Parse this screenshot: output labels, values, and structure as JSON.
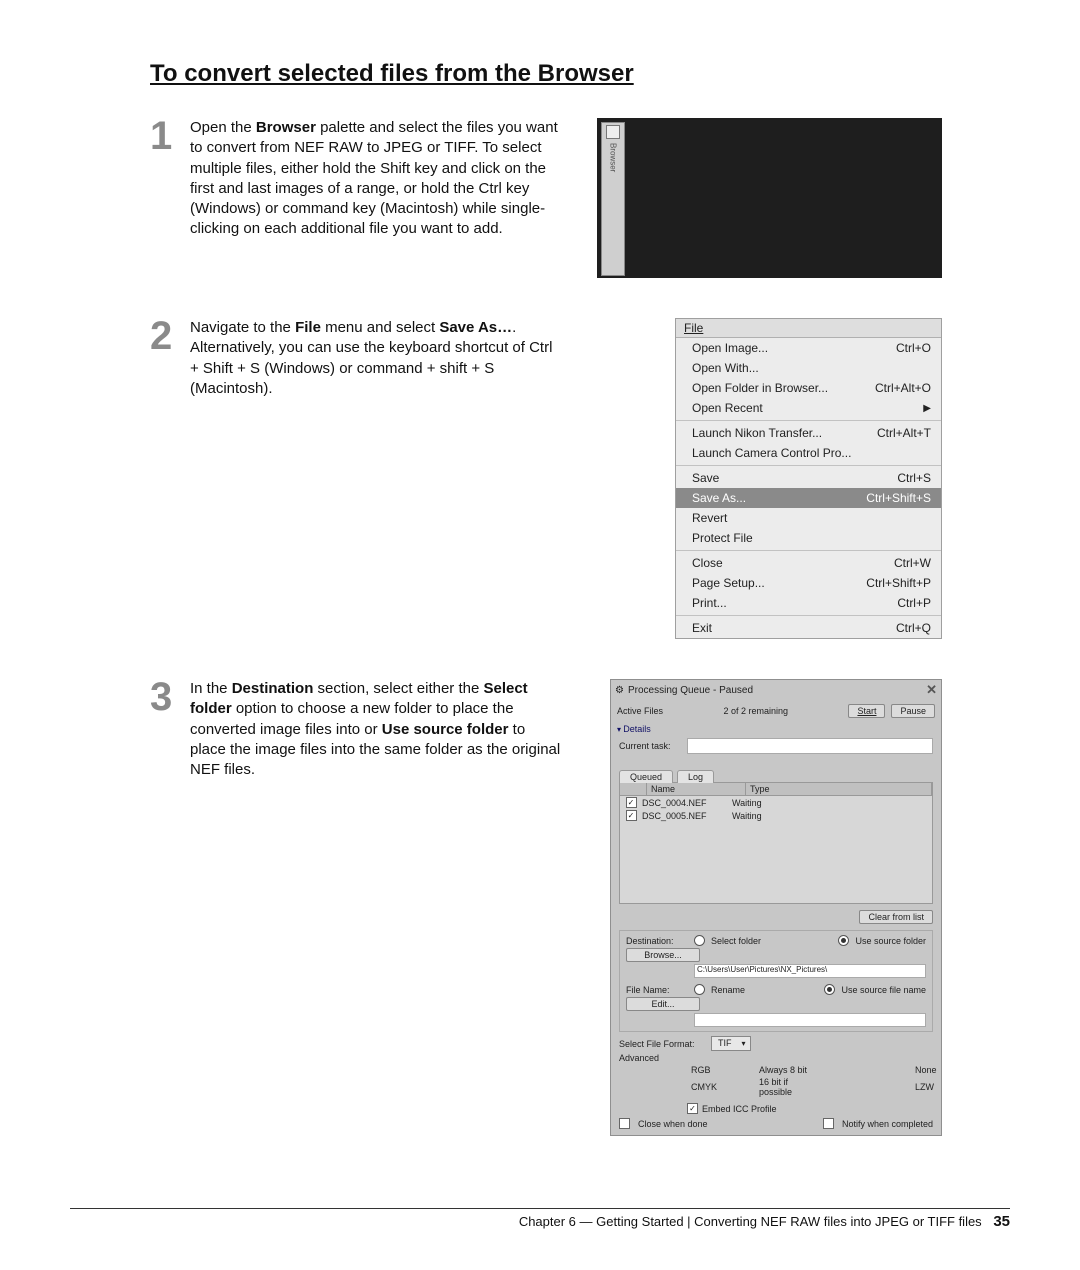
{
  "heading": "To convert selected files from the Browser",
  "steps": [
    {
      "n": "1",
      "paragraph": [
        "Open the ",
        [
          "b",
          "Browser"
        ],
        " palette and select the files you want to convert from NEF RAW to JPEG or TIFF. To select multiple files, either hold the Shift key and click on the first and last images of a range, or hold the Ctrl key (Windows) or command key (Macintosh) while single-clicking on each additional file you want to add."
      ]
    },
    {
      "n": "2",
      "paragraph": [
        "Navigate to the ",
        [
          "b",
          "File"
        ],
        " menu and select ",
        [
          "b",
          "Save As…"
        ],
        ". Alternatively, you can use the keyboard shortcut of Ctrl + Shift + S (Windows) or command + shift + S (Macintosh)."
      ]
    },
    {
      "n": "3",
      "paragraph": [
        "In the ",
        [
          "b",
          "Destination"
        ],
        " section, select either the ",
        [
          "b",
          "Select folder"
        ],
        " option to choose a new folder to place the converted image files into or ",
        [
          "b",
          "Use source folder"
        ],
        " to place the image files into the same folder as the original NEF files."
      ]
    }
  ],
  "browser": {
    "tab": "Browser"
  },
  "file_menu": {
    "title": "File",
    "items": [
      {
        "label": "Open Image...",
        "shortcut": "Ctrl+O",
        "type": "item"
      },
      {
        "label": "Open With...",
        "shortcut": "",
        "type": "item"
      },
      {
        "label": "Open Folder in Browser...",
        "shortcut": "Ctrl+Alt+O",
        "type": "item"
      },
      {
        "label": "Open Recent",
        "shortcut": "",
        "type": "sub"
      },
      {
        "type": "sep"
      },
      {
        "label": "Launch Nikon Transfer...",
        "shortcut": "Ctrl+Alt+T",
        "type": "item"
      },
      {
        "label": "Launch Camera Control Pro...",
        "shortcut": "",
        "type": "item"
      },
      {
        "type": "sep"
      },
      {
        "label": "Save",
        "shortcut": "Ctrl+S",
        "type": "item"
      },
      {
        "label": "Save As...",
        "shortcut": "Ctrl+Shift+S",
        "type": "item",
        "hl": true
      },
      {
        "label": "Revert",
        "shortcut": "",
        "type": "item"
      },
      {
        "label": "Protect File",
        "shortcut": "",
        "type": "item"
      },
      {
        "type": "sep"
      },
      {
        "label": "Close",
        "shortcut": "Ctrl+W",
        "type": "item"
      },
      {
        "label": "Page Setup...",
        "shortcut": "Ctrl+Shift+P",
        "type": "item"
      },
      {
        "label": "Print...",
        "shortcut": "Ctrl+P",
        "type": "item"
      },
      {
        "type": "sep"
      },
      {
        "label": "Exit",
        "shortcut": "Ctrl+Q",
        "type": "item"
      }
    ]
  },
  "pq": {
    "title": "Processing Queue - Paused",
    "active_files": "Active Files",
    "remaining": "2 of 2 remaining",
    "start": "Start",
    "pause": "Pause",
    "details": "Details",
    "current_task": "Current task:",
    "tabs": [
      "Queued",
      "Log"
    ],
    "cols": {
      "name": "Name",
      "type": "Type"
    },
    "rows": [
      {
        "file": "DSC_0004.NEF",
        "status": "Waiting"
      },
      {
        "file": "DSC_0005.NEF",
        "status": "Waiting"
      }
    ],
    "clear": "Clear from list",
    "dest_lbl": "Destination:",
    "browse": "Browse...",
    "select_folder": "Select folder",
    "use_source": "Use source folder",
    "path": "C:\\Users\\User\\Pictures\\NX_Pictures\\",
    "file_name_lbl": "File Name:",
    "edit": "Edit...",
    "rename": "Rename",
    "use_source_name": "Use source file name",
    "file_format_lbl": "Select File Format:",
    "file_format": "TIF",
    "advanced": "Advanced",
    "opt_rgb": "RGB",
    "opt_cmyk": "CMYK",
    "opt_8": "Always 8 bit",
    "opt_16": "16 bit if possible",
    "opt_none": "None",
    "opt_lzw": "LZW",
    "embed": "Embed ICC Profile",
    "close_done": "Close when done",
    "notify": "Notify when completed"
  },
  "footer": {
    "crumb": "Chapter 6 — Getting Started | Converting NEF RAW files into JPEG or TIFF files",
    "page": "35"
  }
}
